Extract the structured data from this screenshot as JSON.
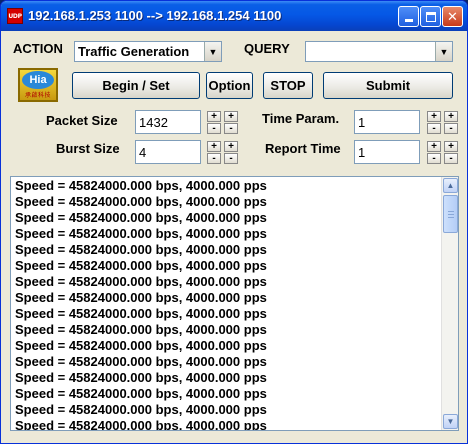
{
  "window": {
    "app_icon_text": "UDP",
    "title": "192.168.1.253  1100 --> 192.168.1.254  1100",
    "minimize_icon": "minimize-icon",
    "maximize_icon": "maximize-icon",
    "close_icon": "close-icon",
    "close_glyph": "✕"
  },
  "controls": {
    "action_label": "ACTION",
    "action_value": "Traffic Generation",
    "query_label": "QUERY",
    "query_value": "",
    "dropdown_arrow": "▼"
  },
  "logo": {
    "text": "Hia",
    "subtext": "承啟科技"
  },
  "buttons": {
    "begin_set": "Begin / Set",
    "option": "Option",
    "stop": "STOP",
    "submit": "Submit"
  },
  "params": {
    "packet_size_label": "Packet Size",
    "packet_size_value": "1432",
    "burst_size_label": "Burst Size",
    "burst_size_value": "4",
    "time_param_label": "Time Param.",
    "time_param_value": "1",
    "report_time_label": "Report Time",
    "report_time_value": "1",
    "plus": "+",
    "minus": "-"
  },
  "log": {
    "lines": [
      "Speed = 45824000.000 bps, 4000.000 pps",
      "Speed = 45824000.000 bps, 4000.000 pps",
      "Speed = 45824000.000 bps, 4000.000 pps",
      "Speed = 45824000.000 bps, 4000.000 pps",
      "Speed = 45824000.000 bps, 4000.000 pps",
      "Speed = 45824000.000 bps, 4000.000 pps",
      "Speed = 45824000.000 bps, 4000.000 pps",
      "Speed = 45824000.000 bps, 4000.000 pps",
      "Speed = 45824000.000 bps, 4000.000 pps",
      "Speed = 45824000.000 bps, 4000.000 pps",
      "Speed = 45824000.000 bps, 4000.000 pps",
      "Speed = 45824000.000 bps, 4000.000 pps",
      "Speed = 45824000.000 bps, 4000.000 pps",
      "Speed = 45824000.000 bps, 4000.000 pps",
      "Speed = 45824000.000 bps, 4000.000 pps",
      "Speed = 45824000.000 bps, 4000.000 pps"
    ],
    "scroll_up_glyph": "▲",
    "scroll_down_glyph": "▼"
  }
}
